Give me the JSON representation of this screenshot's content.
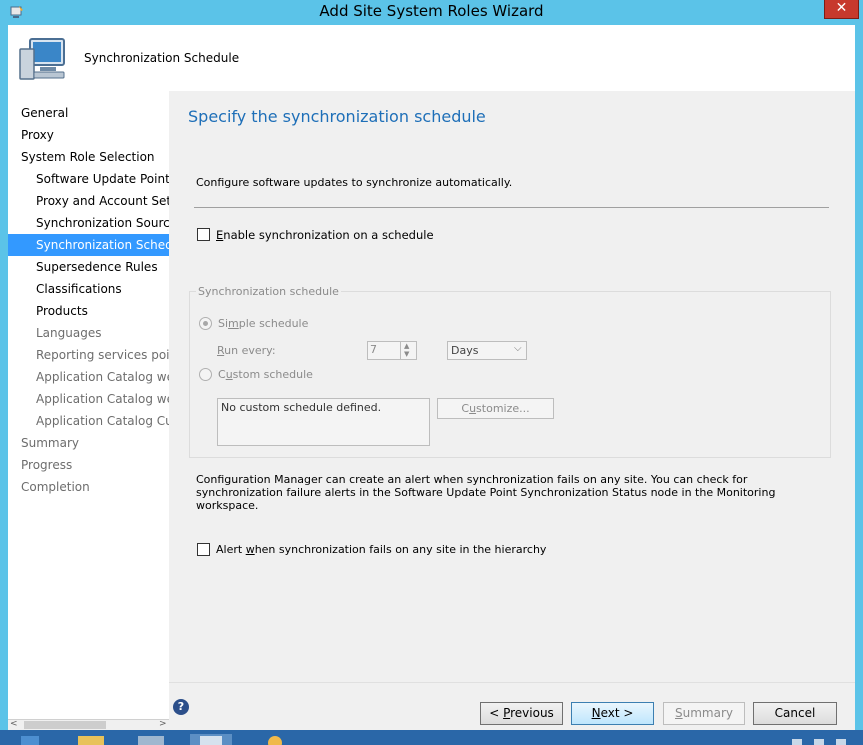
{
  "window": {
    "title": "Add Site System Roles Wizard",
    "close_glyph": "✕"
  },
  "header": {
    "title": "Synchronization Schedule",
    "icon": "computer-wizard-icon"
  },
  "sidebar": {
    "items": [
      {
        "label": "General",
        "level": 0
      },
      {
        "label": "Proxy",
        "level": 0
      },
      {
        "label": "System Role Selection",
        "level": 0
      },
      {
        "label": "Software Update Point",
        "level": 1
      },
      {
        "label": "Proxy and Account Settin",
        "level": 1
      },
      {
        "label": "Synchronization Source",
        "level": 1
      },
      {
        "label": "Synchronization Schedule",
        "level": 1,
        "active": true
      },
      {
        "label": "Supersedence Rules",
        "level": 1
      },
      {
        "label": "Classifications",
        "level": 1
      },
      {
        "label": "Products",
        "level": 1
      },
      {
        "label": "Languages",
        "level": 1,
        "muted": true
      },
      {
        "label": "Reporting services point",
        "level": 1,
        "muted": true
      },
      {
        "label": "Application Catalog web",
        "level": 1,
        "muted": true
      },
      {
        "label": "Application Catalog webs",
        "level": 1,
        "muted": true
      },
      {
        "label": "Application Catalog Cust",
        "level": 1,
        "muted": true
      },
      {
        "label": "Summary",
        "level": 0,
        "muted": true
      },
      {
        "label": "Progress",
        "level": 0,
        "muted": true
      },
      {
        "label": "Completion",
        "level": 0,
        "muted": true
      }
    ],
    "scroll_left": "<",
    "scroll_right": ">"
  },
  "main": {
    "heading": "Specify the synchronization schedule",
    "intro": "Configure software updates to synchronize automatically.",
    "enable_schedule": {
      "prefix": "",
      "accel": "E",
      "rest": "nable synchronization on a schedule",
      "checked": false
    },
    "group_title": "Synchronization schedule",
    "simple_schedule": {
      "prefix": "Si",
      "accel": "m",
      "rest": "ple schedule",
      "selected": true
    },
    "run_every": {
      "prefix": "",
      "accel": "R",
      "rest": "un every:",
      "value": "7",
      "unit": "Days"
    },
    "custom_schedule": {
      "prefix": "C",
      "accel": "u",
      "rest": "stom schedule",
      "selected": false
    },
    "custom_text": "No custom schedule defined.",
    "customize_button": {
      "prefix": "C",
      "accel": "u",
      "rest": "stomize..."
    },
    "alert_note": "Configuration Manager can create an alert when synchronization fails on any site. You can check for synchronization failure alerts in the Software Update Point Synchronization Status node in the Monitoring workspace.",
    "alert_checkbox": {
      "prefix": "Alert ",
      "accel": "w",
      "rest": "hen synchronization fails on any site in the hierarchy",
      "checked": false
    }
  },
  "footer": {
    "help_glyph": "?",
    "previous": {
      "prefix": "< ",
      "accel": "P",
      "rest": "revious"
    },
    "next": {
      "prefix": "",
      "accel": "N",
      "rest": "ext >"
    },
    "summary": {
      "prefix": "",
      "accel": "S",
      "rest": "ummary"
    },
    "cancel": "Cancel"
  },
  "colors": {
    "accent": "#3399ff",
    "heading": "#1e6fb8",
    "titlebar": "#5bc3e8"
  }
}
